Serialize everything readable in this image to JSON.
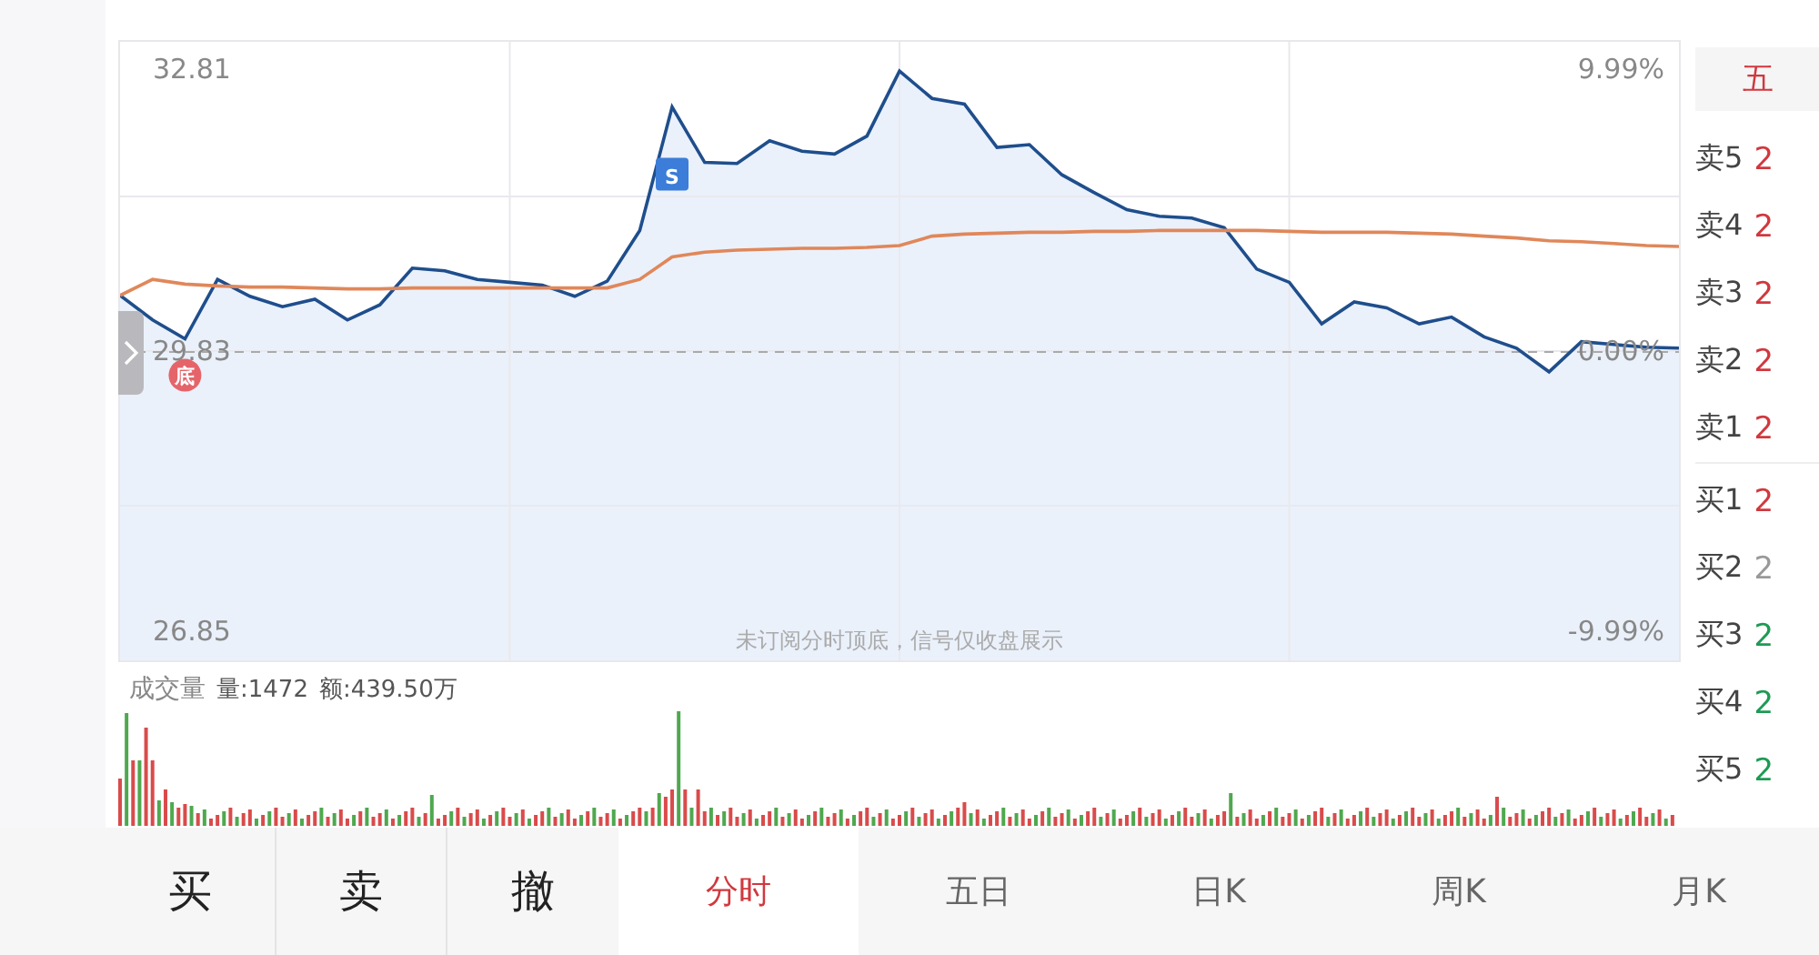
{
  "chart": {
    "percent_labels": [
      "9.99%",
      "0.00%",
      "-9.99%"
    ],
    "notice": "未订阅分时顶底，信号仅收盘展示",
    "signals": [
      {
        "label": "底",
        "kind": "bottom"
      },
      {
        "label": "S",
        "kind": "sell"
      }
    ],
    "chart_data": {
      "type": "line",
      "grid": true,
      "ylim": [
        26.56,
        33.12
      ],
      "yticks": [
        {
          "value": 32.81,
          "label": "32.81"
        },
        {
          "value": 29.83,
          "label": "29.83"
        },
        {
          "value": 26.85,
          "label": "26.85"
        }
      ],
      "categories": [
        null,
        null,
        null,
        null,
        null,
        null,
        null,
        null,
        null,
        null,
        null,
        null,
        null,
        null,
        null,
        null,
        null,
        null,
        null,
        null,
        null,
        null,
        null,
        null,
        null,
        null,
        null,
        null,
        null,
        null,
        null,
        null,
        null,
        null,
        null,
        null,
        null,
        null,
        null,
        null,
        null,
        null,
        null,
        null,
        null,
        null,
        null,
        null,
        null
      ],
      "series": [
        {
          "color": "#1f4e8c",
          "values": [
            30.43,
            30.17,
            29.97,
            30.6,
            30.42,
            30.31,
            30.39,
            30.17,
            30.33,
            30.72,
            30.69,
            30.6,
            30.57,
            30.54,
            30.42,
            30.58,
            31.12,
            32.43,
            31.84,
            31.83,
            32.07,
            31.96,
            31.93,
            32.12,
            32.81,
            32.52,
            32.46,
            32.0,
            32.03,
            31.71,
            31.52,
            31.34,
            31.27,
            31.25,
            31.15,
            30.71,
            30.57,
            30.13,
            30.36,
            30.3,
            30.13,
            30.2,
            29.99,
            29.87,
            29.62,
            29.94,
            29.91,
            29.88,
            29.87
          ]
        },
        {
          "color": "#e0875a",
          "values": [
            30.43,
            30.6,
            30.55,
            30.53,
            30.52,
            30.52,
            30.51,
            30.5,
            30.5,
            30.51,
            30.51,
            30.51,
            30.51,
            30.51,
            30.51,
            30.51,
            30.6,
            30.84,
            30.89,
            30.91,
            30.92,
            30.93,
            30.93,
            30.94,
            30.96,
            31.06,
            31.08,
            31.09,
            31.1,
            31.1,
            31.11,
            31.11,
            31.12,
            31.12,
            31.12,
            31.12,
            31.11,
            31.1,
            31.1,
            31.1,
            31.09,
            31.08,
            31.06,
            31.04,
            31.01,
            31.0,
            30.98,
            30.96,
            30.95
          ]
        }
      ]
    }
  },
  "volume": {
    "title": "成交量",
    "qty": "量:1472",
    "amount": "额:439.50万"
  },
  "order_book": {
    "tab": "五",
    "rows": [
      {
        "label": "卖5",
        "price": "2",
        "color": "#d0383e"
      },
      {
        "label": "卖4",
        "price": "2",
        "color": "#d0383e"
      },
      {
        "label": "卖3",
        "price": "2",
        "color": "#d0383e"
      },
      {
        "label": "卖2",
        "price": "2",
        "color": "#d0383e"
      },
      {
        "label": "卖1",
        "price": "2",
        "color": "#d0383e"
      },
      {
        "label": "买1",
        "price": "2",
        "color": "#d0383e"
      },
      {
        "label": "买2",
        "price": "2",
        "color": "#999999"
      },
      {
        "label": "买3",
        "price": "2",
        "color": "#1e9a55"
      },
      {
        "label": "买4",
        "price": "2",
        "color": "#1e9a55"
      },
      {
        "label": "买5",
        "price": "2",
        "color": "#1e9a55"
      }
    ]
  },
  "actions": [
    "买",
    "卖",
    "撤"
  ],
  "tabs": [
    {
      "label": "分时",
      "selected": true
    },
    {
      "label": "五日",
      "selected": false
    },
    {
      "label": "日K",
      "selected": false
    },
    {
      "label": "周K",
      "selected": false
    },
    {
      "label": "月K",
      "selected": false
    }
  ]
}
